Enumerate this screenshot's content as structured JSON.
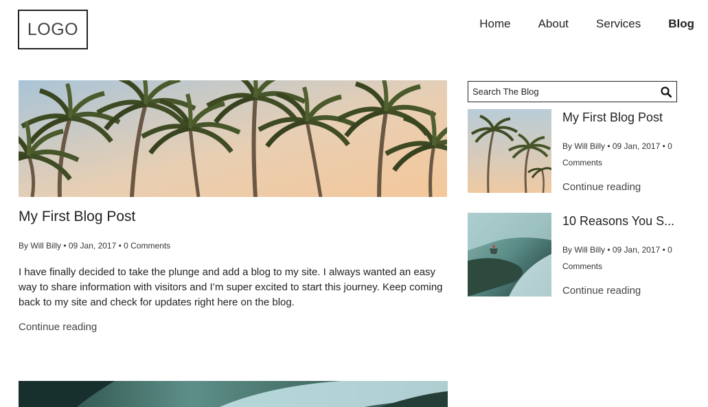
{
  "header": {
    "logo_text": "LOGO",
    "nav": [
      {
        "label": "Home"
      },
      {
        "label": "About"
      },
      {
        "label": "Services"
      },
      {
        "label": "Blog",
        "active": true
      }
    ]
  },
  "main_post": {
    "title": "My First Blog Post",
    "meta": "By Will Billy • 09 Jan, 2017 • 0 Comments",
    "excerpt": "I have finally decided to take the plunge and add a blog to my site. I always wanted an easy way to share information with visitors and I’m super excited to start this journey. Keep coming back to my site and check for updates right here on the blog.",
    "continue_label": "Continue reading"
  },
  "sidebar": {
    "search_placeholder": "Search The Blog",
    "posts": [
      {
        "title": "My First Blog Post",
        "meta": "By Will Billy • 09 Jan, 2017 • 0 Comments",
        "continue_label": "Continue reading"
      },
      {
        "title": "10 Reasons You S...",
        "meta": "By Will Billy • 09 Jan, 2017 • 0 Comments",
        "continue_label": "Continue reading"
      }
    ]
  },
  "icons": {
    "search": "search-icon"
  }
}
